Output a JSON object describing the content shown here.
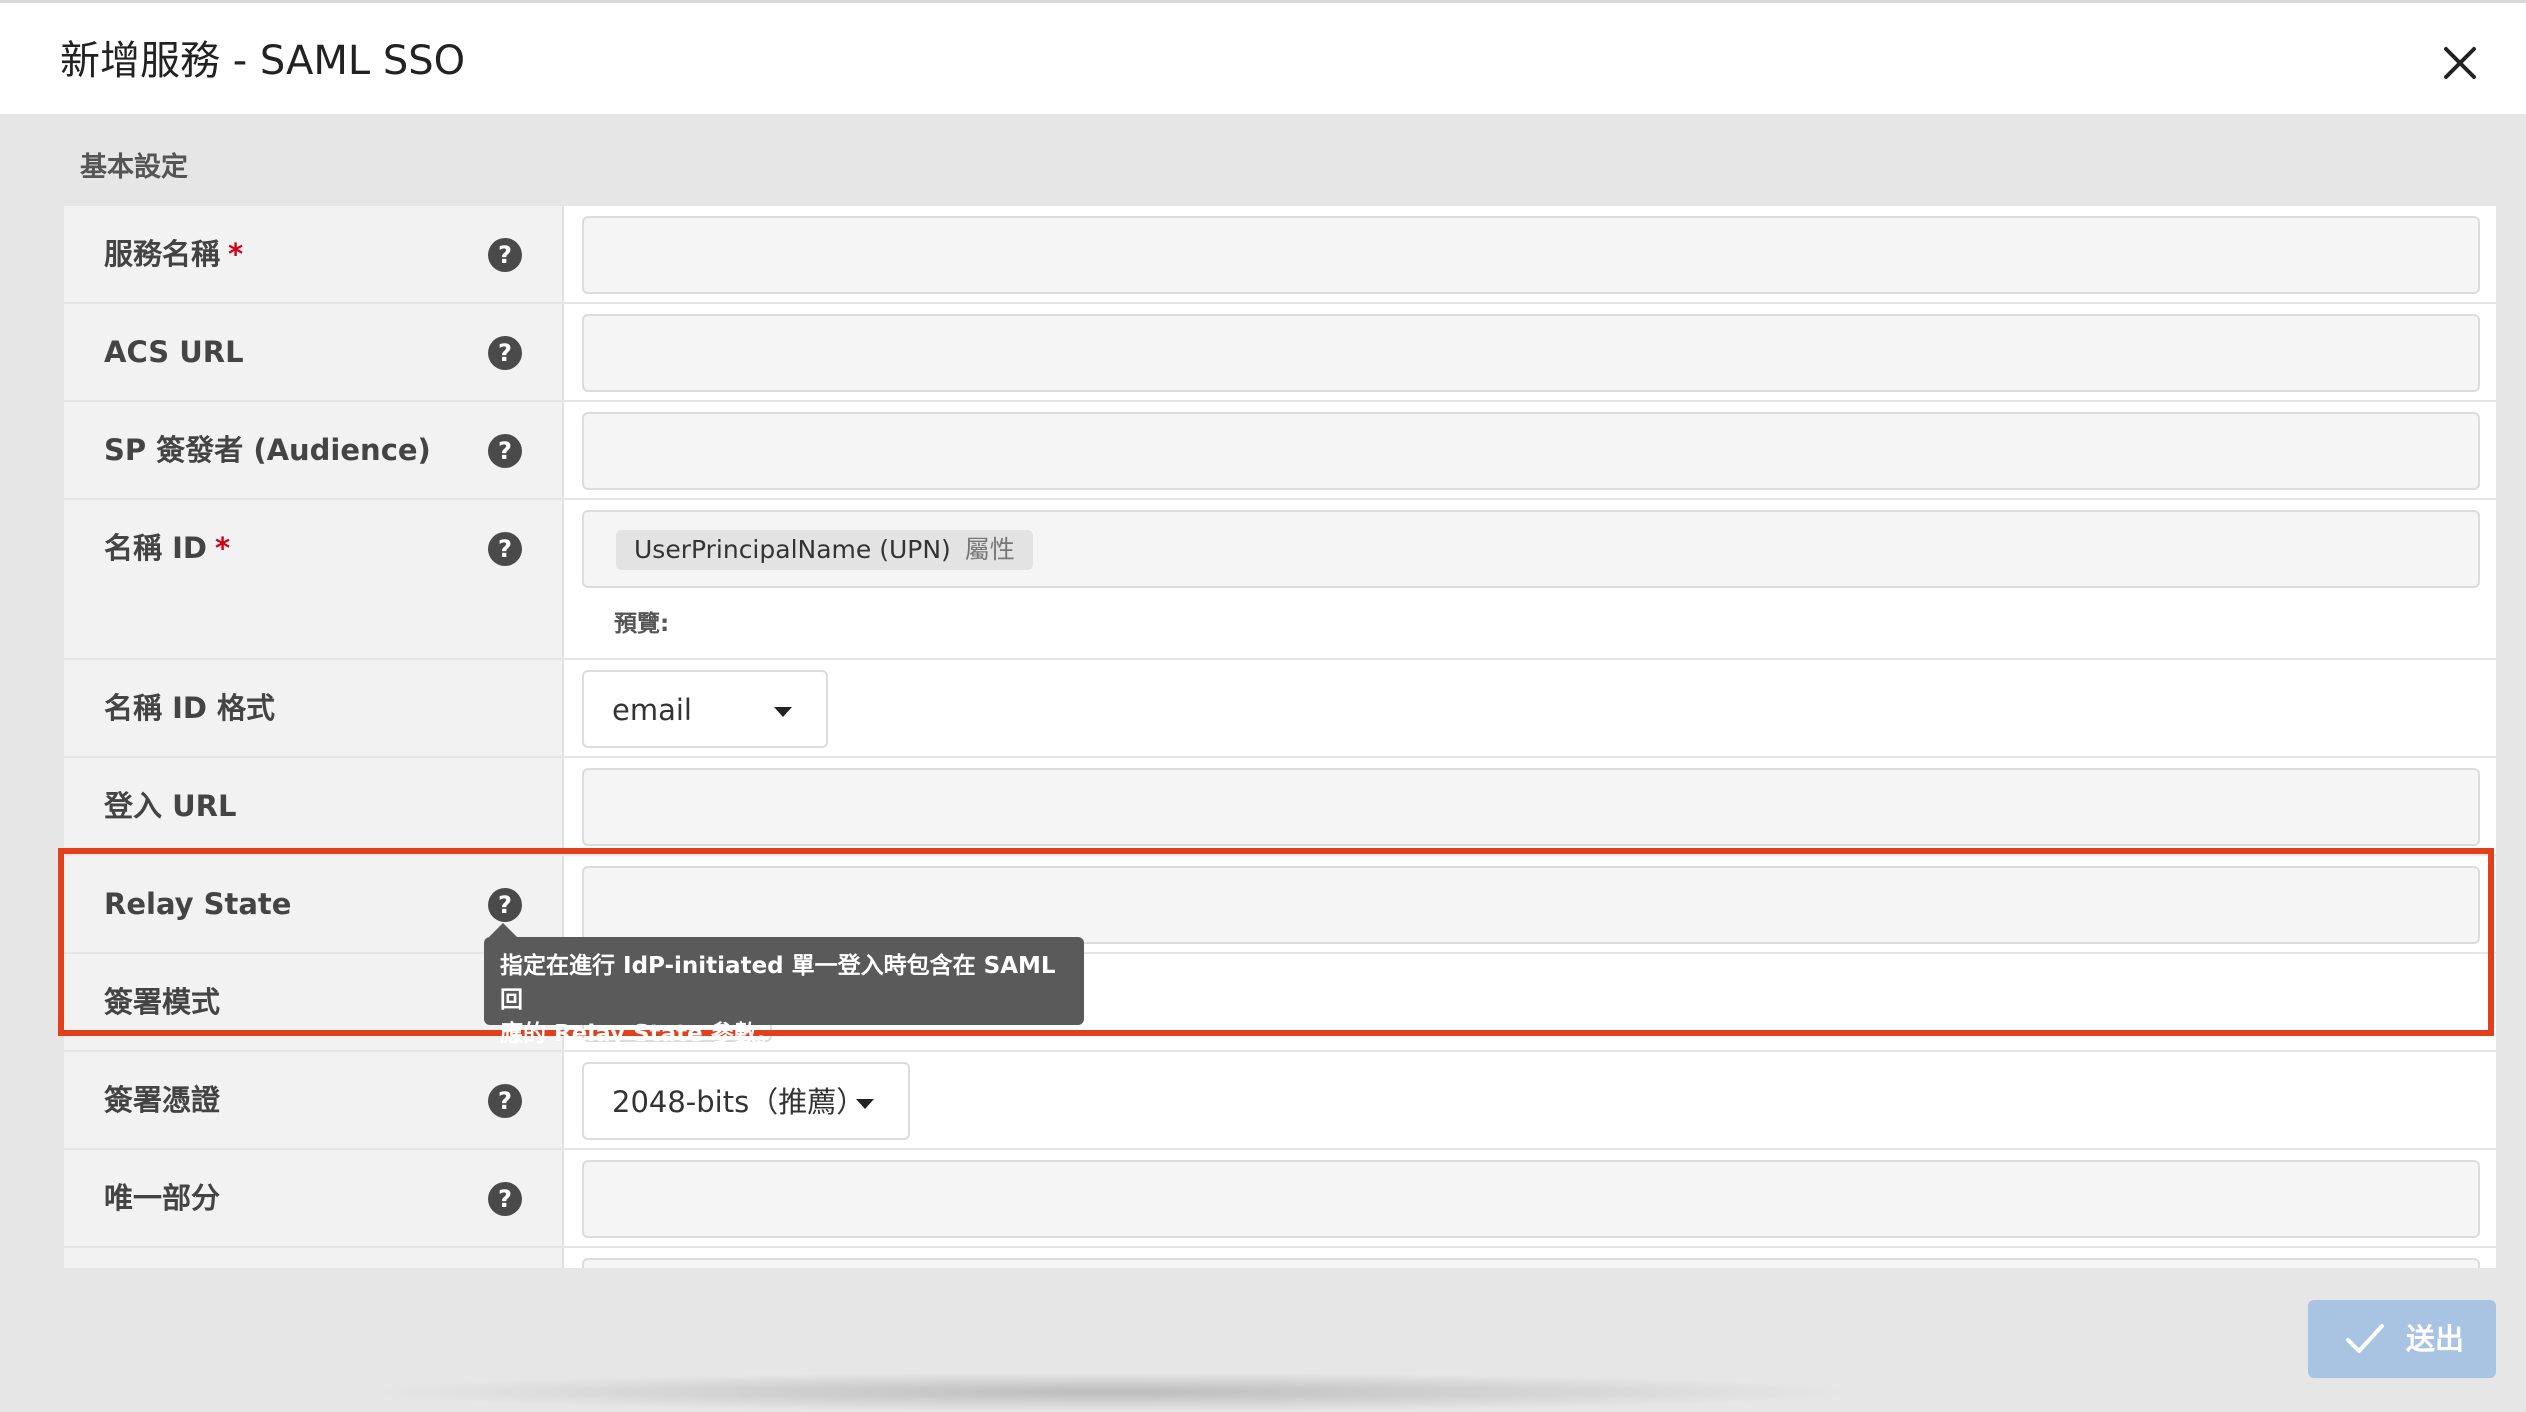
{
  "dialog": {
    "title": "新增服務 - SAML SSO",
    "section_title": "基本設定"
  },
  "fields": [
    {
      "label": "服務名稱",
      "required": "*",
      "value": ""
    },
    {
      "label": "ACS URL",
      "value": ""
    },
    {
      "label": "SP 簽發者 (Audience)",
      "value": ""
    },
    {
      "label": "名稱 ID",
      "required": "*",
      "tag_value": "UserPrincipalName (UPN)",
      "tag_suffix": "屬性",
      "preview_label": "預覽:"
    },
    {
      "label": "名稱 ID 格式",
      "select_value": "email"
    },
    {
      "label": "登入 URL",
      "value": ""
    },
    {
      "label": "Relay State",
      "value": ""
    },
    {
      "label": "簽署模式"
    },
    {
      "label": "簽署憑證",
      "select_value": "2048-bits（推薦）"
    },
    {
      "label": "唯一部分",
      "value": ""
    }
  ],
  "tooltip": {
    "line1": "指定在進行 IdP-initiated 單一登入時包含在 SAML 回",
    "line2": "應的 Relay State 參數。"
  },
  "help_glyph": "?",
  "submit_label": "送出",
  "icons": [
    "close-icon",
    "help-icon",
    "caret-down-icon",
    "check-icon"
  ],
  "colors": {
    "required": "#d0021b",
    "highlight": "#e2401c",
    "submit": "#a9c4e3",
    "tooltip": "#5a5a5a"
  }
}
